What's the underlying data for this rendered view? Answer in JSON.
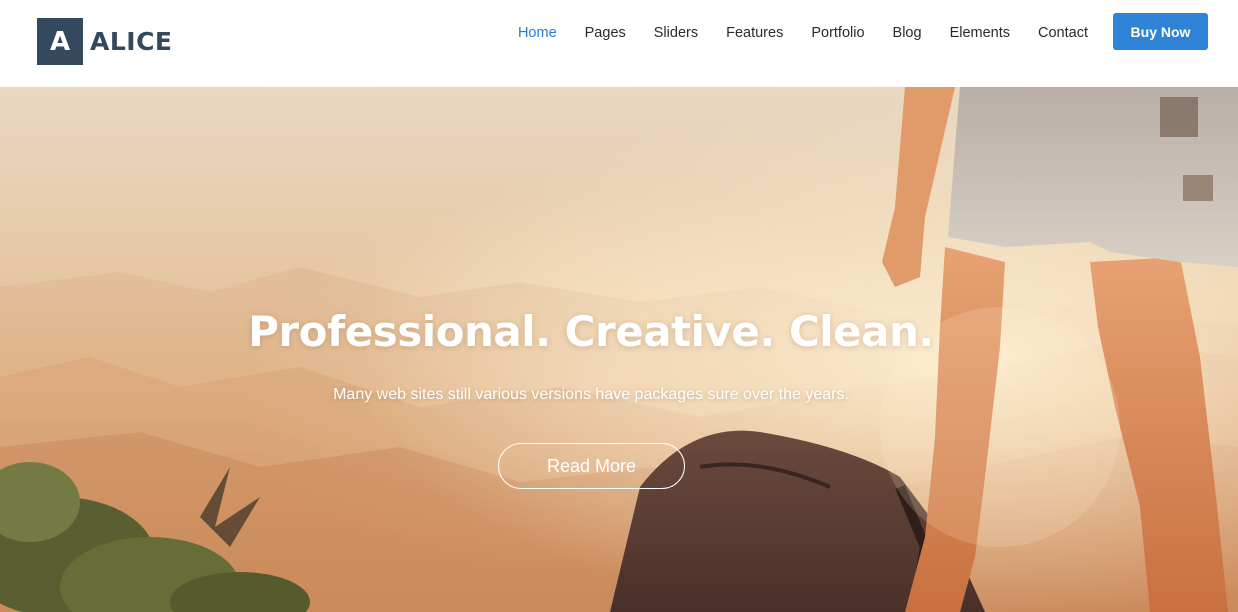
{
  "brand": {
    "mark": "A",
    "name": "ALICE"
  },
  "nav": {
    "items": [
      {
        "label": "Home",
        "active": true
      },
      {
        "label": "Pages"
      },
      {
        "label": "Sliders"
      },
      {
        "label": "Features"
      },
      {
        "label": "Portfolio"
      },
      {
        "label": "Blog"
      },
      {
        "label": "Elements"
      },
      {
        "label": "Contact"
      }
    ],
    "cta_label": "Buy Now"
  },
  "hero": {
    "title": "Professional. Creative. Clean.",
    "subtitle": "Many web sites still various versions have packages sure over the years.",
    "button_label": "Read More"
  },
  "colors": {
    "brand_dark": "#34495e",
    "accent_blue": "#2e83d6",
    "active_nav": "#2b7ad1",
    "text": "#2b2b2b"
  }
}
